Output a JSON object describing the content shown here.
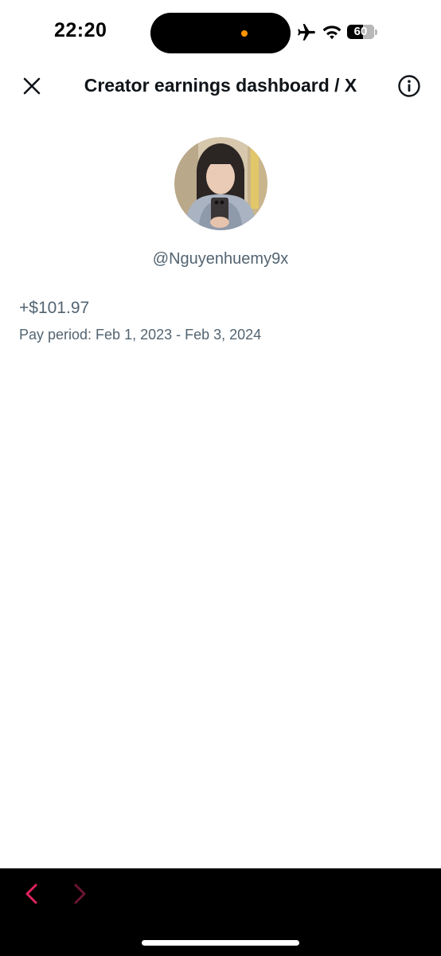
{
  "status_bar": {
    "time": "22:20",
    "battery_level": "60",
    "battery_fraction": 0.6,
    "icons": [
      "airplane-icon",
      "wifi-icon",
      "battery-icon"
    ]
  },
  "header": {
    "title": "Creator earnings dashboard / X",
    "close_icon": "close-icon",
    "info_icon": "info-icon"
  },
  "profile": {
    "username": "@Nguyenhuemy9x",
    "avatar": "profile-photo"
  },
  "earnings": {
    "amount": "+$101.97",
    "pay_period": "Pay period: Feb 1, 2023 - Feb 3, 2024"
  },
  "bottom_bar": {
    "back_icon": "chevron-left-icon",
    "forward_icon": "chevron-right-icon",
    "accent_color": "#e0245e",
    "accent_disabled_color": "#6b1530"
  }
}
